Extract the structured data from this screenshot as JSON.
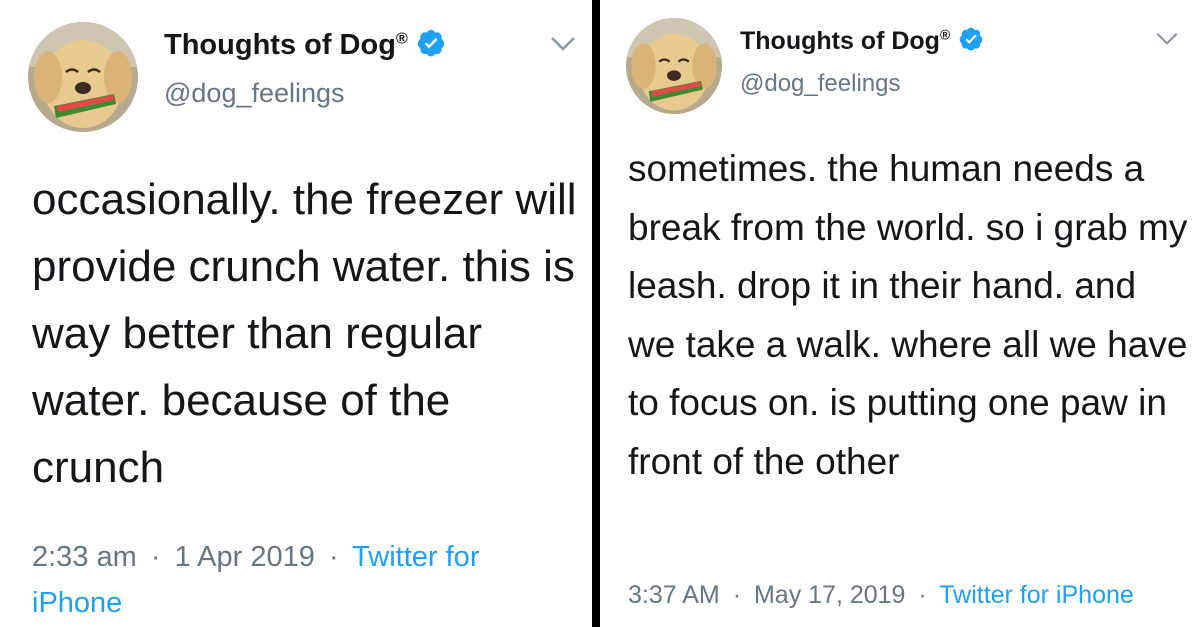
{
  "left_tweet": {
    "author_name": "Thoughts of Dog",
    "registered_mark": "®",
    "handle": "@dog_feelings",
    "text": "occasionally. the freezer will provide crunch water. this is way better than regular water. because of the crunch",
    "time": "2:33 am",
    "date": "1 Apr 2019",
    "separator": "·",
    "source": "Twitter for iPhone",
    "icons": [
      "avatar-dog-photo",
      "verified-badge-icon",
      "chevron-down-icon"
    ]
  },
  "right_tweet": {
    "author_name": "Thoughts of Dog",
    "registered_mark": "®",
    "handle": "@dog_feelings",
    "text": "sometimes. the human needs a break from the world. so i grab my leash. drop it in their hand. and we take a walk. where all we have to focus on. is putting one paw in front of the other",
    "time": "3:37 AM",
    "date": "May 17, 2019",
    "separator": "·",
    "source": "Twitter for iPhone",
    "icons": [
      "avatar-dog-photo",
      "verified-badge-icon",
      "chevron-down-icon"
    ]
  },
  "colors": {
    "text": "#14171a",
    "secondary": "#657786",
    "link": "#1da1f2",
    "verified": "#1da1f2",
    "divider": "#000000"
  }
}
